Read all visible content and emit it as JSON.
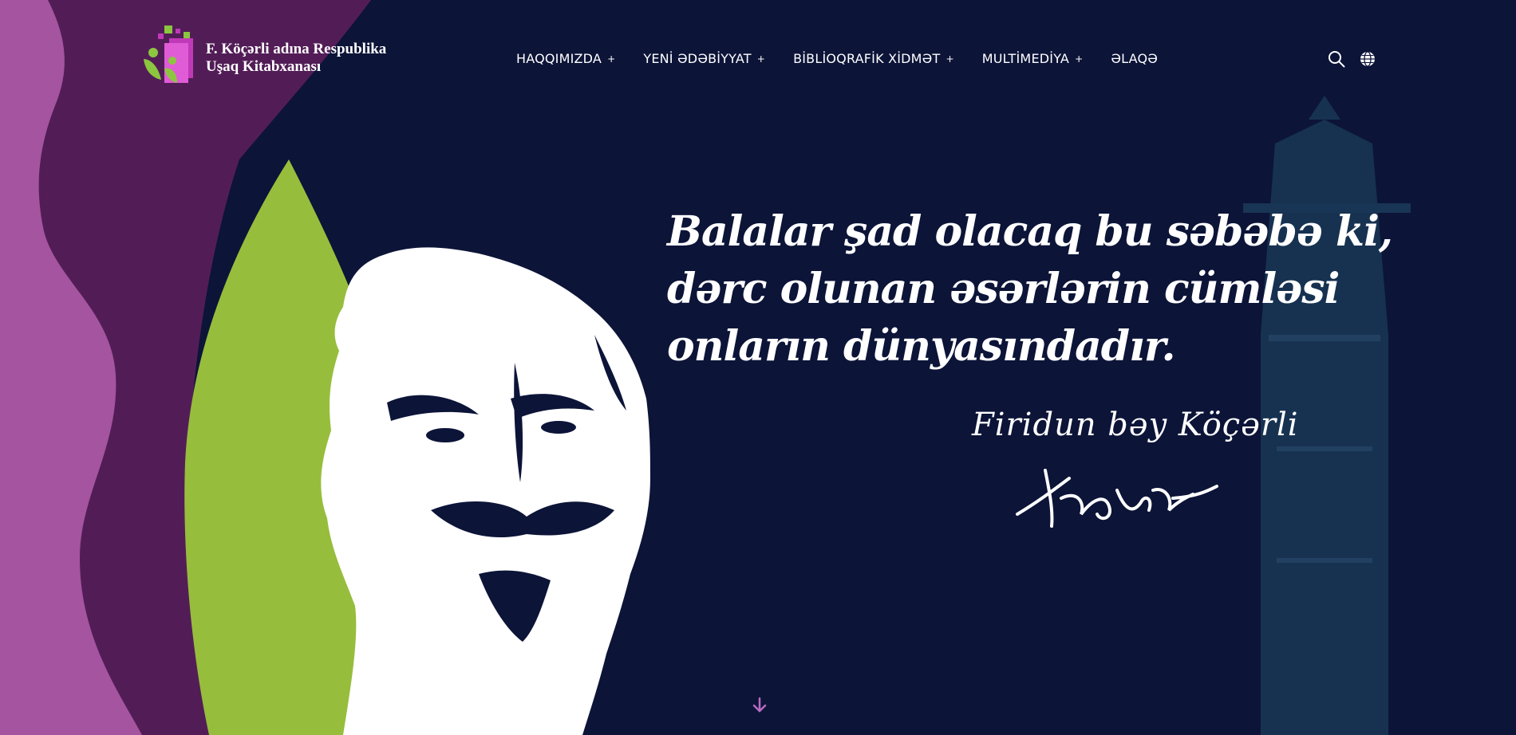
{
  "logo": {
    "line1": "F. Köçərli adına Respublika",
    "line2": "Uşaq Kitabxanası",
    "icon": "library-logo-icon"
  },
  "nav": {
    "items": [
      {
        "label": "HAQQIMIZDA",
        "has_submenu": true
      },
      {
        "label": "YENİ ƏDƏBİYYAT",
        "has_submenu": true
      },
      {
        "label": "BİBLİOQRAFİK XİDMƏT",
        "has_submenu": true
      },
      {
        "label": "MULTİMEDİYA",
        "has_submenu": true
      },
      {
        "label": "ƏLAQƏ",
        "has_submenu": false
      }
    ],
    "submenu_indicator": "+"
  },
  "tools": {
    "search_icon": "search-icon",
    "language_icon": "globe-icon"
  },
  "hero": {
    "quote_lines": [
      "Balalar şad olacaq bu səbəbə ki,",
      "dərc olunan əsərlərin cümləsi",
      "onların dünyasındadır."
    ],
    "author": "Firidun bəy Köçərli",
    "signature_icon": "signature-image",
    "portrait_icon": "portrait-illustration",
    "tower_icon": "maiden-tower-illustration"
  },
  "scroll": {
    "icon": "arrow-down-icon"
  },
  "colors": {
    "background": "#0c1438",
    "purple_light": "#a5549f",
    "purple_dark": "#521d57",
    "green": "#97bd3c",
    "accent": "#b76bc2",
    "text": "#ffffff"
  }
}
